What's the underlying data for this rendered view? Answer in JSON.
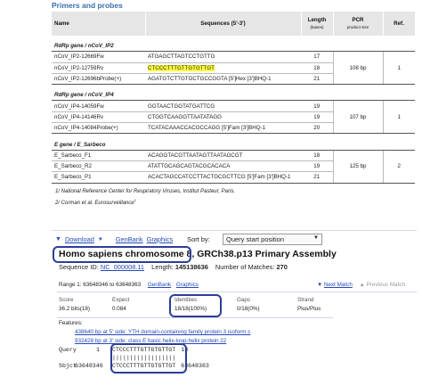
{
  "primers": {
    "heading": "Primers and probes",
    "headers": {
      "name": "Name",
      "sequence": "Sequences (5'-3')",
      "length": "Length",
      "length_sub": "(bases)",
      "pcr": "PCR",
      "pcr_sub": "product size",
      "ref": "Ref."
    },
    "groups": [
      {
        "title": "RdRp gene / nCoV_IP2",
        "pcr": "108 bp",
        "ref": "1",
        "rows": [
          {
            "name": "nCoV_IP2-12669Fw",
            "seq": "ATGAGCTTAGTCCTGTTG",
            "len": "17"
          },
          {
            "name": "nCoV_IP2-12759Rv",
            "seq": "CTCCCTTTGTTGTGTTGT",
            "len": "18"
          },
          {
            "name": "nCoV_IP2-12696bProbe(+)",
            "seq": "AGATGTCTTGTGCTGCCGGTA [5']Hex [3']BHQ-1",
            "len": "21"
          }
        ]
      },
      {
        "title": "RdRp gene / nCoV_IP4",
        "pcr": "107 bp",
        "ref": "1",
        "rows": [
          {
            "name": "nCoV_IP4-14059Fw",
            "seq": "GGTAACTGGTATGATTCG",
            "len": "19"
          },
          {
            "name": "nCoV_IP4-14146Rv",
            "seq": "CTGGTCAAGGTTAATATAGG",
            "len": "19"
          },
          {
            "name": "nCoV_IP4-14084Probe(+)",
            "seq": "TCATACAAACCACGCCAGG [5']Fam [3']BHQ-1",
            "len": "20"
          }
        ]
      },
      {
        "title": "E gene / E_Sarbeco",
        "pcr": "125 bp",
        "ref": "2",
        "rows": [
          {
            "name": "E_Sarbeco_F1",
            "seq": "ACAGGTACGTTAATAGTTAATAGCGT",
            "len": "18"
          },
          {
            "name": "E_Sarbeco_R2",
            "seq": "ATATTGCAGCAGTACGCACACA",
            "len": "19"
          },
          {
            "name": "E_Sarbeco_P1",
            "seq": "ACACTAGCCATCCTTACTGCGCTTCG [5']Fam [3']BHQ-1",
            "len": "21"
          }
        ]
      }
    ],
    "footnotes": [
      "1/ National Reference Center for Respiratory Viruses, Institut Pasteur, Paris.",
      "2/ Corman et al. Eurosurveillance"
    ],
    "footnote_sup": "1"
  },
  "blast": {
    "toolbar": {
      "download": "Download",
      "genbank": "GenBank",
      "graphics": "Graphics",
      "sort_label": "Sort by:",
      "sort_value": "Query start position"
    },
    "title_boxed": "Homo sapiens chromosome 8,",
    "title_rest": "GRCh38.p13 Primary Assembly",
    "seqid_label": "Sequence ID:",
    "seqid": "NC_000008.11",
    "length_label": "Length:",
    "length": "145138636",
    "matches_label": "Number of Matches:",
    "matches": "270",
    "range": "Range 1: 63648346 to 63648363",
    "range_genbank": "GenBank",
    "range_graphics": "Graphics",
    "next_match": "Next Match",
    "prev_match": "Previous Match",
    "stats_headers": [
      "Score",
      "Expect",
      "Identities",
      "Gaps",
      "Strand"
    ],
    "stats_values": [
      "36.2 bits(18)",
      "0.084",
      "18/18(100%)",
      "0/18(0%)",
      "Plus/Plus"
    ],
    "features_label": "Features:",
    "features": [
      "438640 bp at 5' side: YTH domain-containing family protein 3 isoform c",
      "932428 bp at 3' side: class E basic helix-loop-helix protein 22"
    ],
    "query_label": "Query",
    "query_start": "1",
    "query_seq": "CTCCCTTTGTTGTGTTGT",
    "query_end": "18",
    "match_line": "||||||||||||||||||",
    "sbjct_label": "Sbjct",
    "sbjct_start": "63648346",
    "sbjct_seq": "CTCCCTTTGTTGTGTTGT",
    "sbjct_end": "63648363"
  }
}
